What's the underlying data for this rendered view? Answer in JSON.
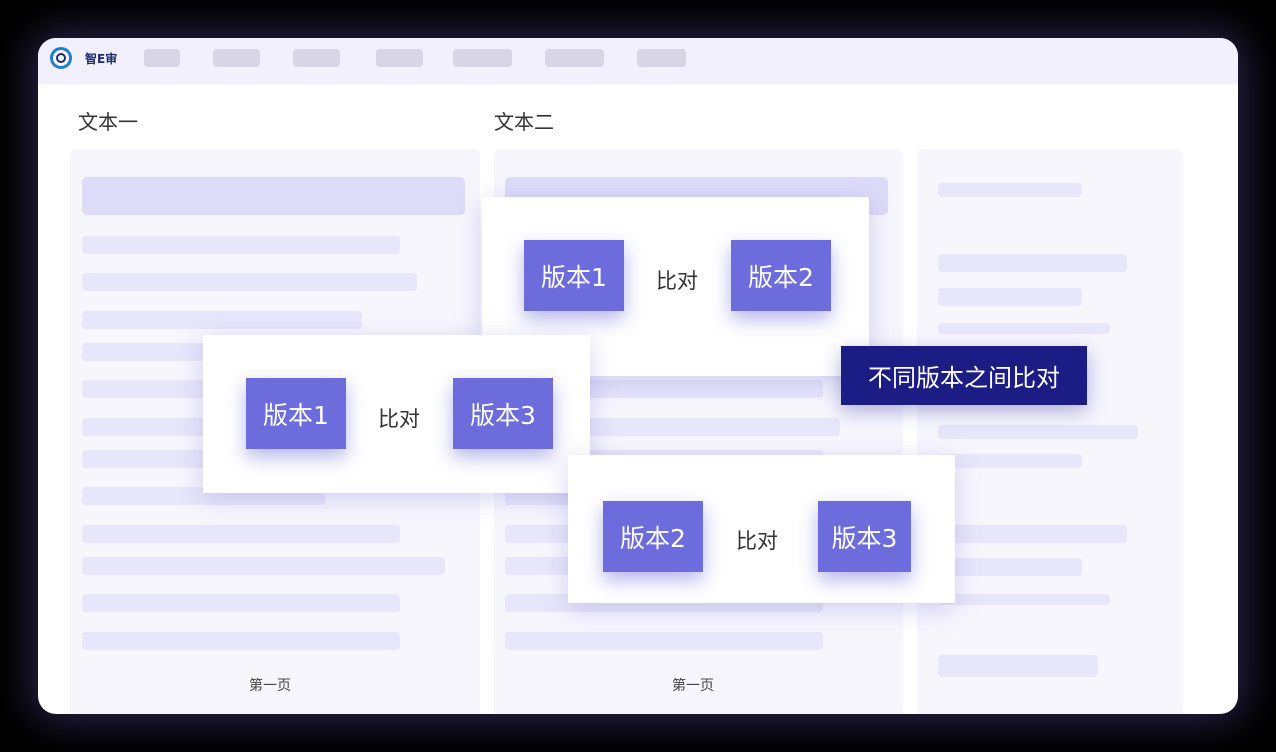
{
  "app": {
    "brand": "智E审"
  },
  "columns": {
    "text1_title": "文本一",
    "text2_title": "文本二",
    "text1_page": "第一页",
    "text2_page": "第一页"
  },
  "comparisons": [
    {
      "left": "版本1",
      "middle": "比对",
      "right": "版本2"
    },
    {
      "left": "版本1",
      "middle": "比对",
      "right": "版本3"
    },
    {
      "left": "版本2",
      "middle": "比对",
      "right": "版本3"
    }
  ],
  "callout": {
    "text": "不同版本之间比对"
  },
  "colors": {
    "accent": "#6c6cdc",
    "callout_bg": "#1b1c84",
    "panel_bg": "#f7f6fd",
    "placeholder_bar": "#e8e6fa"
  },
  "icons": {
    "logo": "ring-logo-icon"
  }
}
